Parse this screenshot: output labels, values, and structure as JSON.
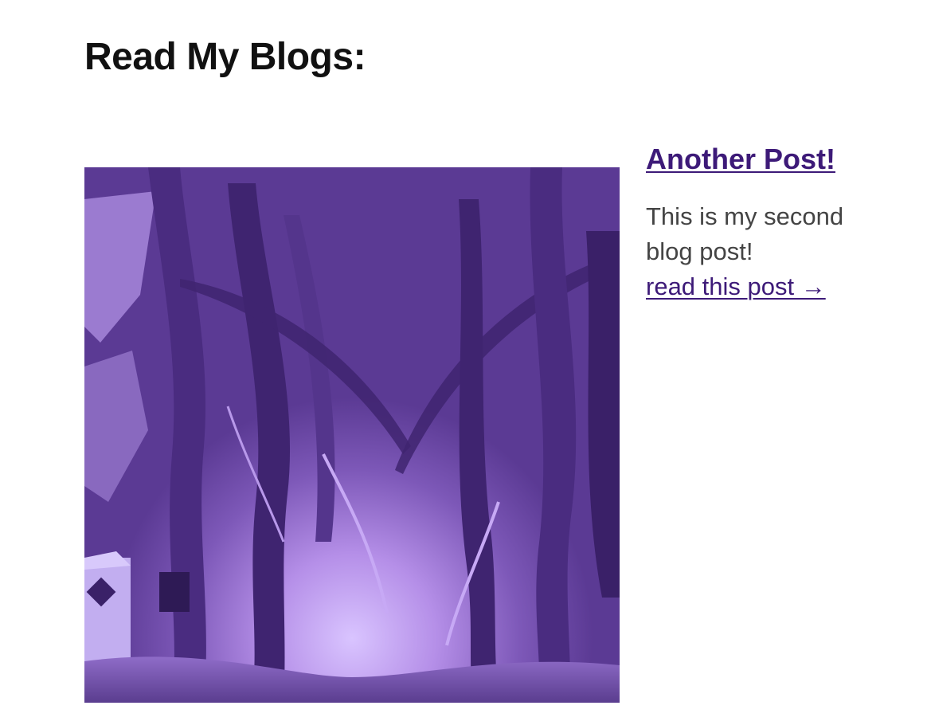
{
  "page": {
    "heading": "Read My Blogs:"
  },
  "posts": [
    {
      "title": "Another Post!",
      "excerpt": "This is my second blog post!",
      "read_link": "read this post →",
      "image": "misty-tree-tunnel-purple-duotone"
    }
  ],
  "colors": {
    "heading": "#111111",
    "link": "#3d1a78",
    "body_text": "#444444",
    "image_tint": "#5b3a94"
  }
}
